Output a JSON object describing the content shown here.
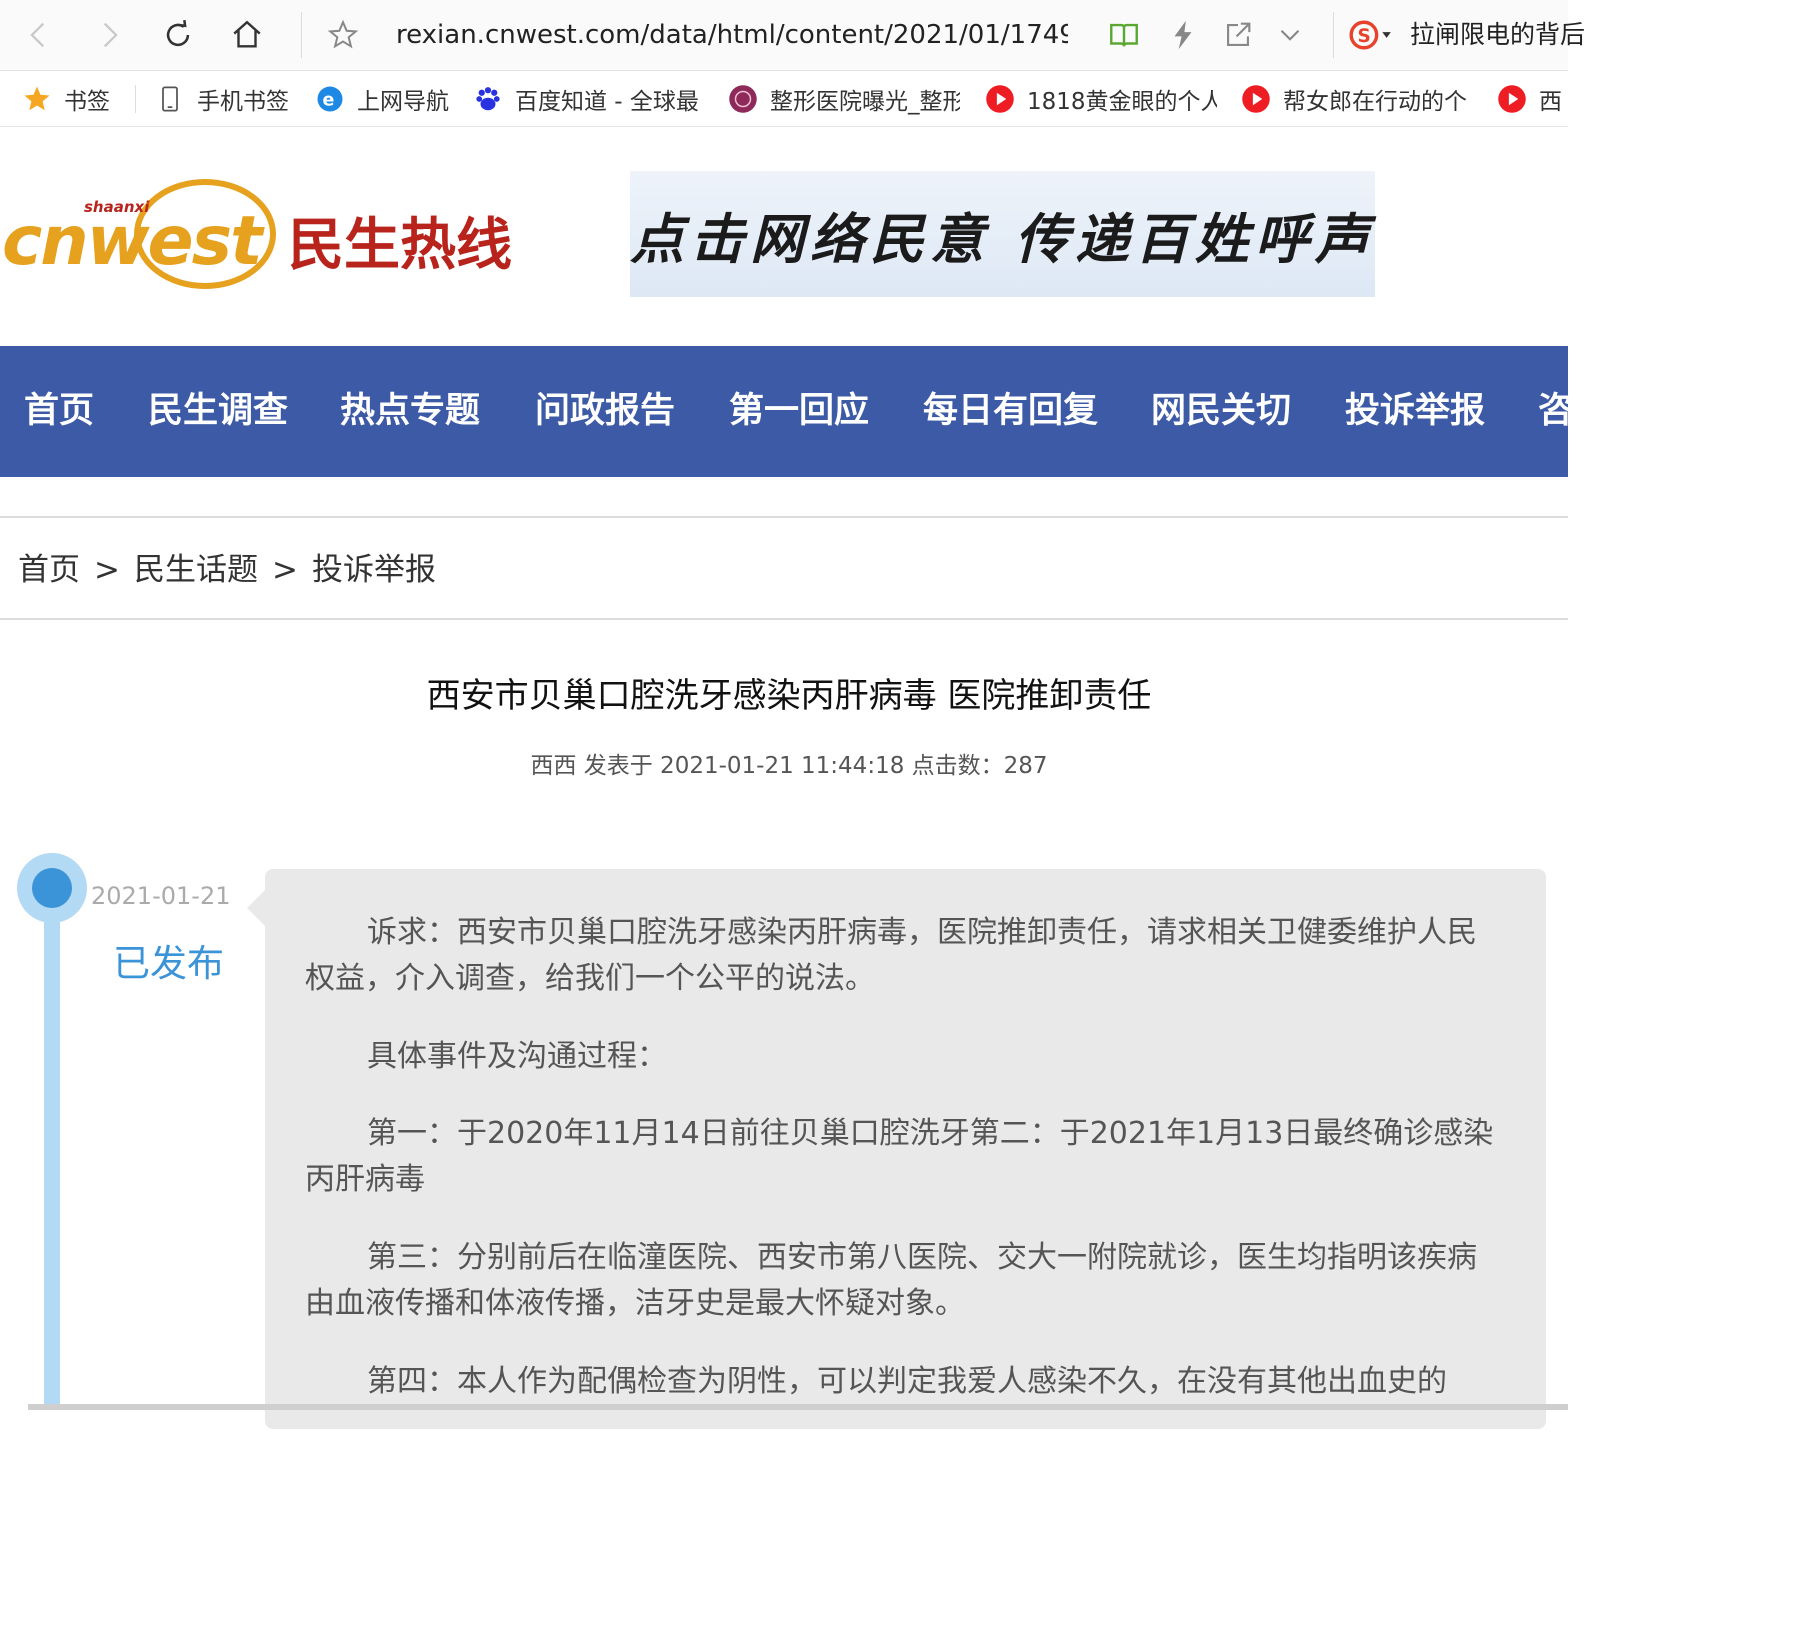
{
  "browser": {
    "url": "rexian.cnwest.com/data/html/content/2021/01/1749",
    "search_text": "拉闸限电的背后"
  },
  "bookmarks": [
    {
      "label": "书签",
      "icon": "star-icon"
    },
    {
      "label": "手机书签",
      "icon": "phone-icon"
    },
    {
      "label": "上网导航",
      "icon": "ie-icon"
    },
    {
      "label": "百度知道 - 全球最",
      "icon": "baidu-paw-icon"
    },
    {
      "label": "整形医院曝光_整形",
      "icon": "hospital-logo-icon"
    },
    {
      "label": "1818黄金眼的个人",
      "icon": "play-icon"
    },
    {
      "label": "帮女郎在行动的个",
      "icon": "play-icon"
    },
    {
      "label": "西",
      "icon": "play-icon"
    }
  ],
  "site": {
    "logo_text": "cnwest",
    "logo_small": "shaanxi",
    "logo_cn": "民生热线",
    "banner_text": "点击网络民意 传递百姓呼声"
  },
  "nav": [
    "首页",
    "民生调查",
    "热点专题",
    "问政报告",
    "第一回应",
    "每日有回复",
    "网民关切",
    "投诉举报",
    "咨"
  ],
  "breadcrumb": [
    "首页",
    "民生话题",
    "投诉举报"
  ],
  "breadcrumb_sep": ">",
  "article": {
    "title": "西安市贝巢口腔洗牙感染丙肝病毒 医院推卸责任",
    "meta": "西西 发表于 2021-01-21 11:44:18 点击数：287",
    "timeline_date": "2021-01-21",
    "timeline_status": "已发布",
    "paragraphs": [
      "诉求：西安市贝巢口腔洗牙感染丙肝病毒，医院推卸责任，请求相关卫健委维护人民权益，介入调查，给我们一个公平的说法。",
      "具体事件及沟通过程：",
      "第一：于2020年11月14日前往贝巢口腔洗牙第二：于2021年1月13日最终确诊感染丙肝病毒",
      "第三：分别前后在临潼医院、西安市第八医院、交大一附院就诊，医生均指明该疾病由血液传播和体液传播，洁牙史是最大怀疑对象。",
      "第四：本人作为配偶检查为阴性，可以判定我爱人感染不久，在没有其他出血史的"
    ]
  },
  "colors": {
    "nav_bg": "#3d5aa6",
    "timeline_blue": "#3b93d8",
    "timeline_light": "#b3daf4",
    "card_bg": "#e9e9e9",
    "logo_orange": "#e6a21e",
    "logo_dark": "#b8241c"
  }
}
